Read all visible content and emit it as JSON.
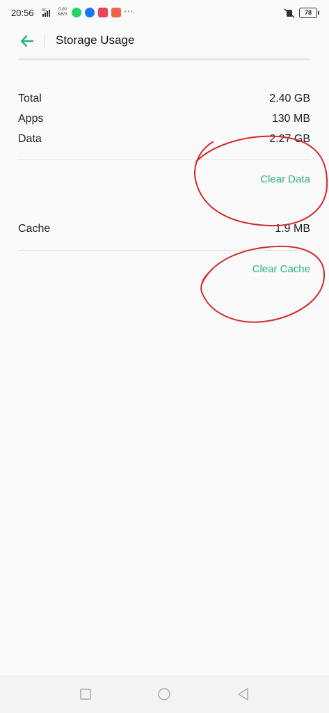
{
  "status_bar": {
    "time": "20:56",
    "network": "4G",
    "speed_value": "0.00",
    "speed_unit": "KB/S",
    "apps": [
      "whatsapp-icon",
      "facebook-icon",
      "messenger-icon",
      "calendar-icon"
    ],
    "more": "···",
    "battery": "78"
  },
  "header": {
    "title": "Storage Usage"
  },
  "storage": {
    "rows": [
      {
        "label": "Total",
        "value": "2.40 GB"
      },
      {
        "label": "Apps",
        "value": "130 MB"
      },
      {
        "label": "Data",
        "value": "2.27 GB"
      }
    ],
    "clear_data_label": "Clear Data",
    "cache": {
      "label": "Cache",
      "value": "1.9 MB"
    },
    "clear_cache_label": "Clear Cache"
  },
  "colors": {
    "accent": "#2db37a",
    "annotation": "#d22a2a",
    "background": "#fafafa"
  },
  "nav": {
    "icons": [
      "recent-apps-icon",
      "home-icon",
      "back-nav-icon"
    ]
  }
}
